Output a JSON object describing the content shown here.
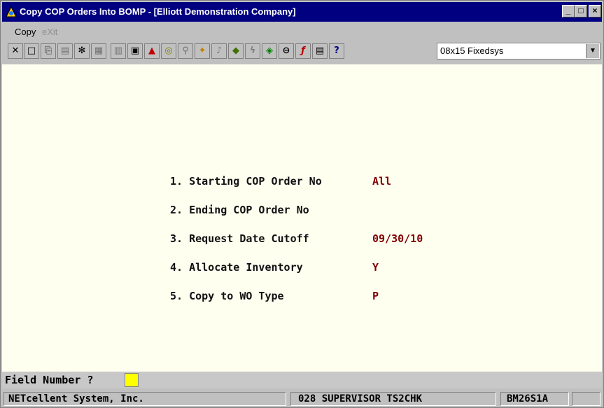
{
  "window": {
    "title": "Copy COP Orders Into BOMP - [Elliott Demonstration Company]",
    "min_glyph": "_",
    "max_glyph": "□",
    "close_glyph": "×"
  },
  "menu": {
    "copy": "Copy",
    "exit": "eXit"
  },
  "toolbar": {
    "font_select": "08x15 Fixedsys",
    "icons": [
      "close-x-icon",
      "select-icon",
      "copy-icon",
      "paste-icon",
      "settings-icon",
      "properties-icon",
      "list-icon",
      "printer-icon",
      "warning-icon",
      "binoculars-icon",
      "search-icon",
      "gear-icon",
      "wizard-icon",
      "doc-icon",
      "lightning-icon",
      "run-icon",
      "link-icon",
      "function-icon",
      "notes-icon",
      "help-icon"
    ]
  },
  "form": {
    "fields": [
      {
        "label": "1. Starting COP Order No",
        "value": "All"
      },
      {
        "label": "2. Ending COP Order No",
        "value": ""
      },
      {
        "label": "3. Request Date Cutoff",
        "value": "09/30/10"
      },
      {
        "label": "4. Allocate Inventory",
        "value": "Y"
      },
      {
        "label": "5. Copy to WO Type",
        "value": "P"
      }
    ]
  },
  "prompt": {
    "label": "Field Number ?",
    "value": ""
  },
  "status": {
    "company": "NETcellent System, Inc.",
    "user": "028 SUPERVISOR TS2CHK",
    "program": "BM26S1A"
  },
  "colors": {
    "titlebar": "#000080",
    "screen_bg": "#fffff0",
    "value_text": "#800000",
    "cursor": "#ffff00"
  }
}
